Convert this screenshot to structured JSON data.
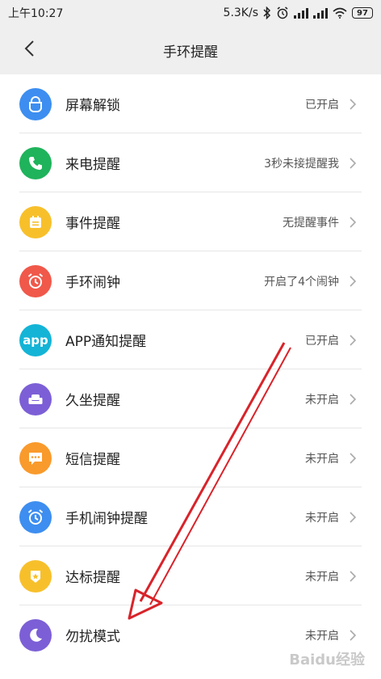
{
  "status_bar": {
    "time": "上午10:27",
    "speed": "5.3K/s",
    "battery": "97"
  },
  "header": {
    "title": "手环提醒"
  },
  "items": [
    {
      "label": "屏幕解锁",
      "status": "已开启",
      "icon": "unlock-icon",
      "color": "#3d8ef0"
    },
    {
      "label": "来电提醒",
      "status": "3秒未接提醒我",
      "icon": "phone-icon",
      "color": "#1fb35b"
    },
    {
      "label": "事件提醒",
      "status": "无提醒事件",
      "icon": "calendar-icon",
      "color": "#f7c02b"
    },
    {
      "label": "手环闹钟",
      "status": "开启了4个闹钟",
      "icon": "alarm-icon",
      "color": "#f0584a"
    },
    {
      "label": "APP通知提醒",
      "status": "已开启",
      "icon": "app-icon",
      "icon_text": "app",
      "color": "#14b4d6"
    },
    {
      "label": "久坐提醒",
      "status": "未开启",
      "icon": "sofa-icon",
      "color": "#7c5fd6"
    },
    {
      "label": "短信提醒",
      "status": "未开启",
      "icon": "message-icon",
      "color": "#f99a2c"
    },
    {
      "label": "手机闹钟提醒",
      "status": "未开启",
      "icon": "phone-alarm-icon",
      "color": "#3d8ef0"
    },
    {
      "label": "达标提醒",
      "status": "未开启",
      "icon": "badge-icon",
      "color": "#f7c02b"
    },
    {
      "label": "勿扰模式",
      "status": "未开启",
      "icon": "moon-icon",
      "color": "#7c5fd6"
    }
  ],
  "watermark": "Baidu经验"
}
